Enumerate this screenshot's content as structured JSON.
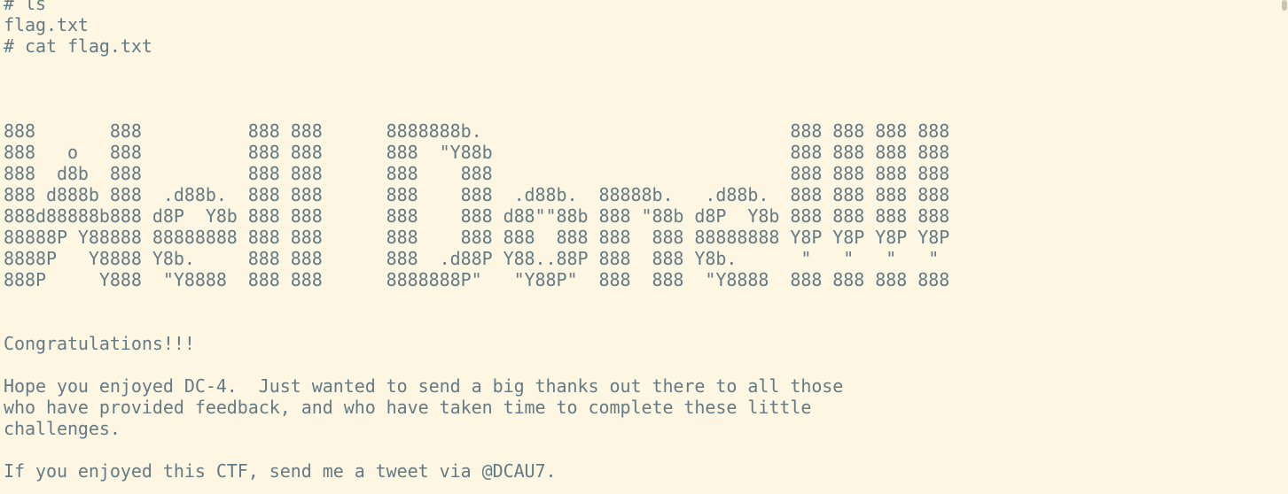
{
  "terminal": {
    "background": "#fdf6e3",
    "foreground": "#657b83",
    "lines": [
      "# ls",
      "flag.txt",
      "# cat flag.txt",
      "",
      "",
      "",
      "888       888          888 888      8888888b.                             888 888 888 888",
      "888   o   888          888 888      888  \"Y88b                            888 888 888 888",
      "888  d8b  888          888 888      888    888                            888 888 888 888",
      "888 d888b 888  .d88b.  888 888      888    888  .d88b.  88888b.   .d88b.  888 888 888 888",
      "888d88888b888 d8P  Y8b 888 888      888    888 d88\"\"88b 888 \"88b d8P  Y8b 888 888 888 888",
      "88888P Y88888 88888888 888 888      888    888 888  888 888  888 88888888 Y8P Y8P Y8P Y8P",
      "8888P   Y8888 Y8b.     888 888      888  .d88P Y88..88P 888  888 Y8b.      \"   \"   \"   \"",
      "888P     Y888  \"Y8888  888 888      8888888P\"   \"Y88P\"  888  888  \"Y8888  888 888 888 888",
      "",
      "",
      "Congratulations!!!",
      "",
      "Hope you enjoyed DC-4.  Just wanted to send a big thanks out there to all those",
      "who have provided feedback, and who have taken time to complete these little",
      "challenges.",
      "",
      "If you enjoyed this CTF, send me a tweet via @DCAU7."
    ]
  }
}
